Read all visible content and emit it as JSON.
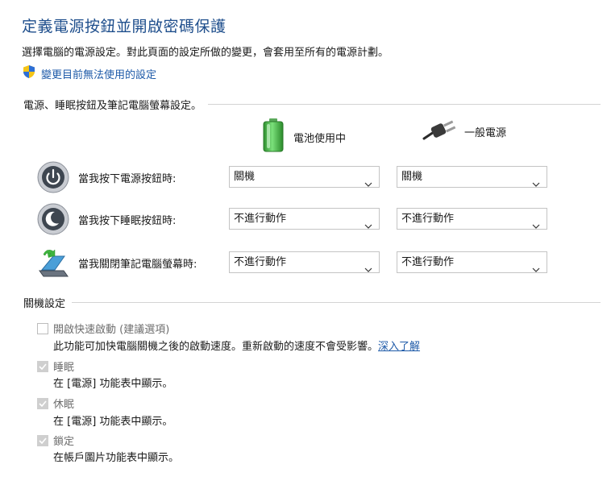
{
  "page": {
    "title": "定義電源按鈕並開啟密碼保護",
    "subtitle": "選擇電腦的電源設定。對此頁面的設定所做的變更，會套用至所有的電源計劃。",
    "change_link": "變更目前無法使用的設定"
  },
  "power_section": {
    "header": "電源、睡眠按鈕及筆記電腦螢幕設定。",
    "columns": {
      "battery": "電池使用中",
      "plugged_in": "一般電源"
    },
    "rows": [
      {
        "label": "當我按下電源按鈕時:",
        "battery_value": "關機",
        "plugged_value": "關機",
        "icon": "power-button-icon"
      },
      {
        "label": "當我按下睡眠按鈕時:",
        "battery_value": "不進行動作",
        "plugged_value": "不進行動作",
        "icon": "sleep-button-icon"
      },
      {
        "label": "當我關閉筆記電腦螢幕時:",
        "battery_value": "不進行動作",
        "plugged_value": "不進行動作",
        "icon": "laptop-lid-icon"
      }
    ]
  },
  "shutdown_section": {
    "header": "關機設定",
    "options": [
      {
        "label": "開啟快速啟動 (建議選項)",
        "checked": false,
        "description": "此功能可加快電腦關機之後的啟動速度。重新啟動的速度不會受影響。",
        "link": "深入了解"
      },
      {
        "label": "睡眠",
        "checked": true,
        "description": "在 [電源] 功能表中顯示。"
      },
      {
        "label": "休眠",
        "checked": true,
        "description": "在 [電源] 功能表中顯示。"
      },
      {
        "label": "鎖定",
        "checked": true,
        "description": "在帳戶圖片功能表中顯示。"
      }
    ]
  },
  "colors": {
    "title": "#1e4e8c",
    "link": "#1e5aa8",
    "battery_green": "#3fb53f",
    "disabled_text": "#6d6d6d"
  }
}
